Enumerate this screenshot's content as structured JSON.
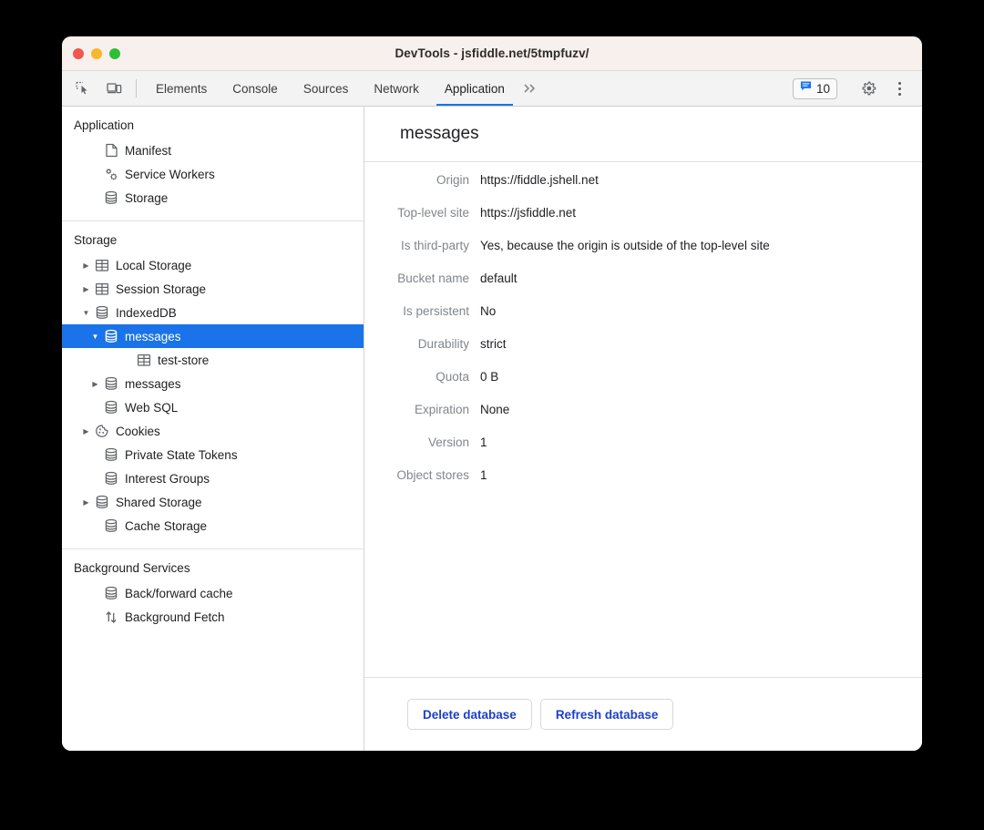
{
  "window": {
    "title": "DevTools - jsfiddle.net/5tmpfuzv/",
    "traffic_colors": {
      "close": "#f2574f",
      "minimize": "#f8b72c",
      "maximize": "#2dbf35"
    }
  },
  "toolbar": {
    "left_icons": [
      {
        "name": "inspect-element-icon",
        "label": "Inspect element"
      },
      {
        "name": "device-toolbar-icon",
        "label": "Toggle device toolbar"
      }
    ],
    "tabs": [
      {
        "label": "Elements",
        "active": false
      },
      {
        "label": "Console",
        "active": false
      },
      {
        "label": "Sources",
        "active": false
      },
      {
        "label": "Network",
        "active": false
      },
      {
        "label": "Application",
        "active": true
      }
    ],
    "more_tabs_label": "»",
    "console_badge": {
      "count": "10",
      "icon": "message-icon"
    },
    "settings_icon": "gear-icon",
    "menu_icon": "kebab-menu-icon",
    "accent_color": "#1a73e8"
  },
  "sidebar": {
    "sections": [
      {
        "title": "Application",
        "items": [
          {
            "label": "Manifest",
            "icon": "document-icon",
            "arrow": "none",
            "indent": 2,
            "selected": false
          },
          {
            "label": "Service Workers",
            "icon": "gears-icon",
            "arrow": "none",
            "indent": 2,
            "selected": false
          },
          {
            "label": "Storage",
            "icon": "database-icon",
            "arrow": "none",
            "indent": 2,
            "selected": false
          }
        ]
      },
      {
        "title": "Storage",
        "items": [
          {
            "label": "Local Storage",
            "icon": "table-icon",
            "arrow": "collapsed",
            "indent": 1,
            "selected": false
          },
          {
            "label": "Session Storage",
            "icon": "table-icon",
            "arrow": "collapsed",
            "indent": 1,
            "selected": false
          },
          {
            "label": "IndexedDB",
            "icon": "database-icon",
            "arrow": "expanded",
            "indent": 1,
            "selected": false
          },
          {
            "label": "messages",
            "icon": "database-icon",
            "arrow": "expanded",
            "indent": 2,
            "selected": true
          },
          {
            "label": "test-store",
            "icon": "table-icon",
            "arrow": "none",
            "indent": 4,
            "selected": false
          },
          {
            "label": "messages",
            "icon": "database-icon",
            "arrow": "collapsed",
            "indent": 2,
            "selected": false
          },
          {
            "label": "Web SQL",
            "icon": "database-icon",
            "arrow": "none",
            "indent": 1,
            "selected": false
          },
          {
            "label": "Cookies",
            "icon": "cookie-icon",
            "arrow": "collapsed",
            "indent": 1,
            "selected": false
          },
          {
            "label": "Private State Tokens",
            "icon": "database-icon",
            "arrow": "none",
            "indent": 1,
            "selected": false
          },
          {
            "label": "Interest Groups",
            "icon": "database-icon",
            "arrow": "none",
            "indent": 1,
            "selected": false
          },
          {
            "label": "Shared Storage",
            "icon": "database-icon",
            "arrow": "collapsed",
            "indent": 1,
            "selected": false
          },
          {
            "label": "Cache Storage",
            "icon": "database-icon",
            "arrow": "none",
            "indent": 1,
            "selected": false
          }
        ]
      },
      {
        "title": "Background Services",
        "items": [
          {
            "label": "Back/forward cache",
            "icon": "database-icon",
            "arrow": "none",
            "indent": 2,
            "selected": false
          },
          {
            "label": "Background Fetch",
            "icon": "sync-arrows-icon",
            "arrow": "none",
            "indent": 2,
            "selected": false
          }
        ]
      }
    ],
    "selection_color": "#1a73e8"
  },
  "main": {
    "heading": "messages",
    "fields": [
      {
        "key": "Origin",
        "value": "https://fiddle.jshell.net"
      },
      {
        "key": "Top-level site",
        "value": "https://jsfiddle.net"
      },
      {
        "key": "Is third-party",
        "value": "Yes, because the origin is outside of the top-level site"
      },
      {
        "key": "Bucket name",
        "value": "default"
      },
      {
        "key": "Is persistent",
        "value": "No"
      },
      {
        "key": "Durability",
        "value": "strict"
      },
      {
        "key": "Quota",
        "value": "0 B"
      },
      {
        "key": "Expiration",
        "value": "None"
      },
      {
        "key": "Version",
        "value": "1"
      },
      {
        "key": "Object stores",
        "value": "1"
      }
    ],
    "buttons": [
      {
        "label": "Delete database",
        "name": "delete-database-button"
      },
      {
        "label": "Refresh database",
        "name": "refresh-database-button"
      }
    ],
    "button_text_color": "#1a3fcf"
  }
}
